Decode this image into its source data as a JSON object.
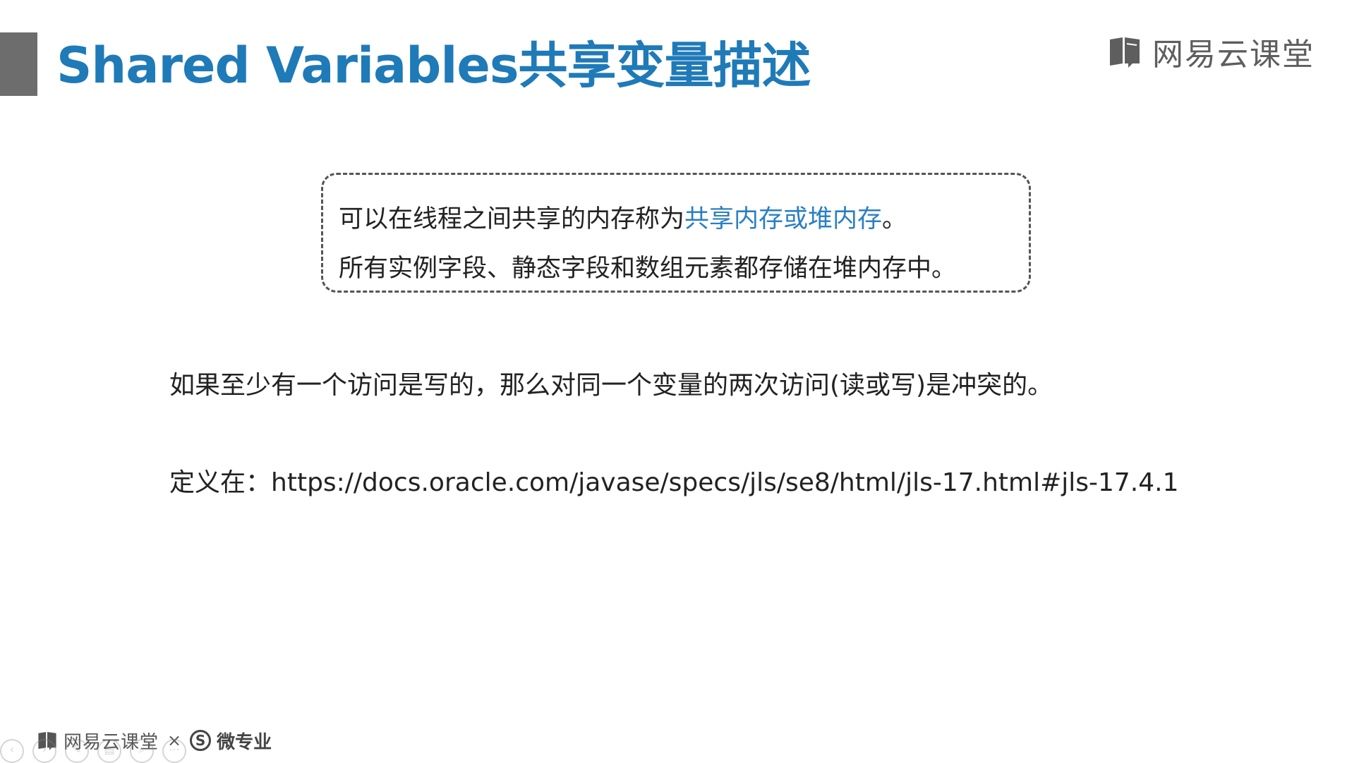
{
  "title": "Shared Variables共享变量描述",
  "brand": {
    "text": "网易云课堂",
    "icon": "book-icon"
  },
  "box": {
    "line1_prefix": "可以在线程之间共享的内存称为",
    "line1_highlight": "共享内存或堆内存",
    "line1_suffix": "。",
    "line2": "所有实例字段、静态字段和数组元素都存储在堆内存中。",
    "highlight_color": "#2a7fc3"
  },
  "conflict_text": "如果至少有一个访问是写的，那么对同一个变量的两次访问(读或写)是冲突的。",
  "definition": {
    "label": "定义在：",
    "url": "https://docs.oracle.com/javase/specs/jls/se8/html/jls-17.html#jls-17.4.1"
  },
  "footer": {
    "brand": "网易云课堂",
    "separator": "×",
    "s_mark": "S",
    "partner": "微专业"
  },
  "controls": [
    {
      "icon": "prev-icon",
      "glyph": "‹"
    },
    {
      "icon": "next-icon",
      "glyph": "›"
    },
    {
      "icon": "pen-icon",
      "glyph": "✎"
    },
    {
      "icon": "menu-icon",
      "glyph": "▤"
    },
    {
      "icon": "zoom-icon",
      "glyph": "⌕"
    },
    {
      "icon": "more-icon",
      "glyph": "⋯"
    }
  ],
  "colors": {
    "title": "#1f7ab8",
    "accent_block": "#6d6d6d"
  }
}
